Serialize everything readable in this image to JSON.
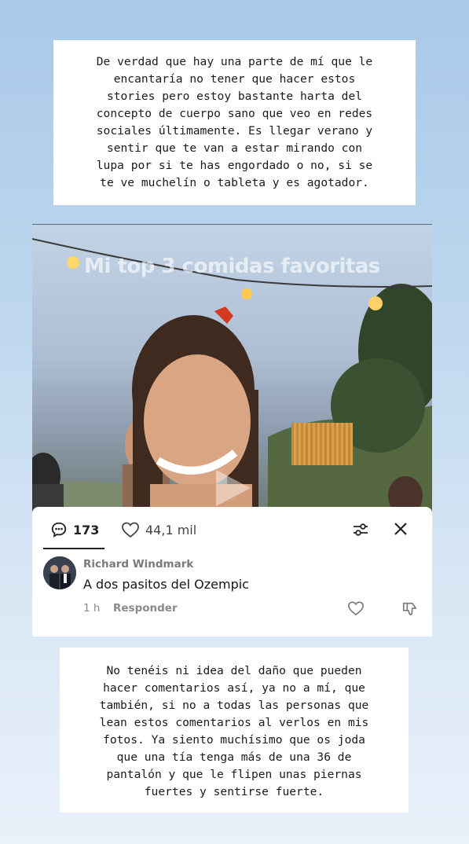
{
  "story": {
    "top_text": "De verdad que hay una parte de mí que le\nencantaría no tener que hacer estos\nstories pero estoy bastante harta del\nconcepto de cuerpo sano que veo en redes\nsociales últimamente. Es llegar verano y\nsentir que te van a estar mirando con\nlupa por si te has engordado o no, si se\nte ve muchelín o tableta y es agotador.",
    "bottom_text": "No tenéis ni idea del daño que pueden\nhacer comentarios así, ya no a mí, que\ntambién, si no a todas las personas que\nlean estos comentarios al verlos en mis\nfotos. Ya siento muchísimo que os joda\nque una tía tenga más de una 36 de\npantalón y que le flipen unas piernas\nfuertes y sentirse fuerte."
  },
  "video": {
    "title": "Mi top 3 comidas favoritas"
  },
  "comments_panel": {
    "comment_count": "173",
    "like_count": "44,1 mil",
    "comment": {
      "author": "Richard Windmark",
      "text": "A dos pasitos del Ozempic",
      "time": "1 h",
      "reply_label": "Responder"
    }
  },
  "icons": [
    "comment-bubble-icon",
    "heart-icon",
    "filter-icon",
    "close-icon",
    "play-icon",
    "heart-outline-icon",
    "dislike-icon"
  ],
  "colors": {
    "background_top": "#a9c9e8",
    "background_bottom": "#e9f1fa",
    "panel": "#ffffff",
    "text_dark": "#1b1b1b",
    "muted": "#8a8a8a"
  }
}
